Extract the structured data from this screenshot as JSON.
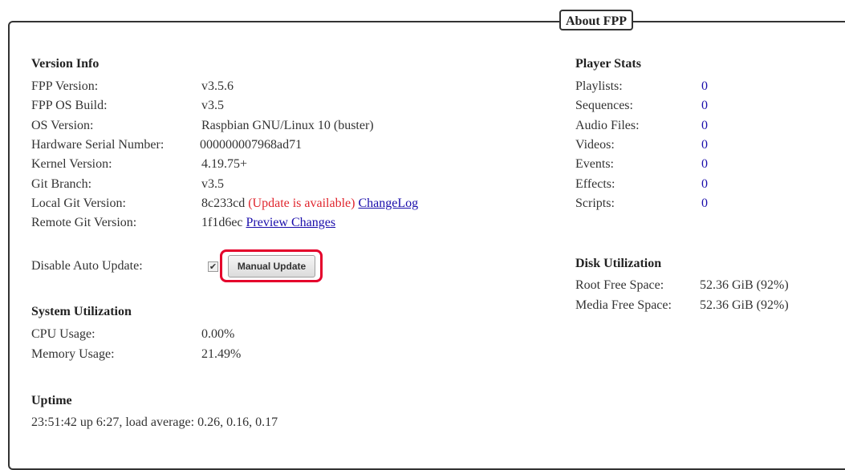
{
  "fieldset": {
    "legend": "About FPP"
  },
  "version_info": {
    "title": "Version Info",
    "rows": [
      {
        "label": "FPP Version:",
        "value": "v3.5.6"
      },
      {
        "label": "FPP OS Build:",
        "value": "v3.5"
      },
      {
        "label": "OS Version:",
        "value": "Raspbian GNU/Linux 10 (buster)"
      },
      {
        "label": "Hardware Serial Number:",
        "value": "000000007968ad71"
      },
      {
        "label": "Kernel Version:",
        "value": "4.19.75+"
      },
      {
        "label": "Git Branch:",
        "value": "v3.5"
      }
    ],
    "local_git": {
      "label": "Local Git Version:",
      "value": "8c233cd",
      "update_notice": "(Update is available)",
      "changelog_link": "ChangeLog"
    },
    "remote_git": {
      "label": "Remote Git Version:",
      "value": "1f1d6ec",
      "preview_link": "Preview Changes"
    },
    "auto_update": {
      "label": "Disable Auto Update:",
      "checked": true,
      "check_glyph": "✔",
      "manual_update_button": "Manual Update"
    }
  },
  "system_utilization": {
    "title": "System Utilization",
    "rows": [
      {
        "label": "CPU Usage:",
        "value": "0.00%"
      },
      {
        "label": "Memory Usage:",
        "value": "21.49%"
      }
    ]
  },
  "uptime": {
    "title": "Uptime",
    "text": "23:51:42 up 6:27, load average: 0.26, 0.16, 0.17"
  },
  "player_stats": {
    "title": "Player Stats",
    "rows": [
      {
        "label": "Playlists:",
        "value": "0"
      },
      {
        "label": "Sequences:",
        "value": "0"
      },
      {
        "label": "Audio Files:",
        "value": "0"
      },
      {
        "label": "Videos:",
        "value": "0"
      },
      {
        "label": "Events:",
        "value": "0"
      },
      {
        "label": "Effects:",
        "value": "0"
      },
      {
        "label": "Scripts:",
        "value": "0"
      }
    ]
  },
  "disk_utilization": {
    "title": "Disk Utilization",
    "rows": [
      {
        "label": "Root Free Space:",
        "value": "52.36 GiB (92%)"
      },
      {
        "label": "Media Free Space:",
        "value": "52.36 GiB (92%)"
      }
    ]
  },
  "colors": {
    "link": "#1a0dab",
    "update_notice": "#e0262e",
    "highlight_box": "#e4002b"
  }
}
